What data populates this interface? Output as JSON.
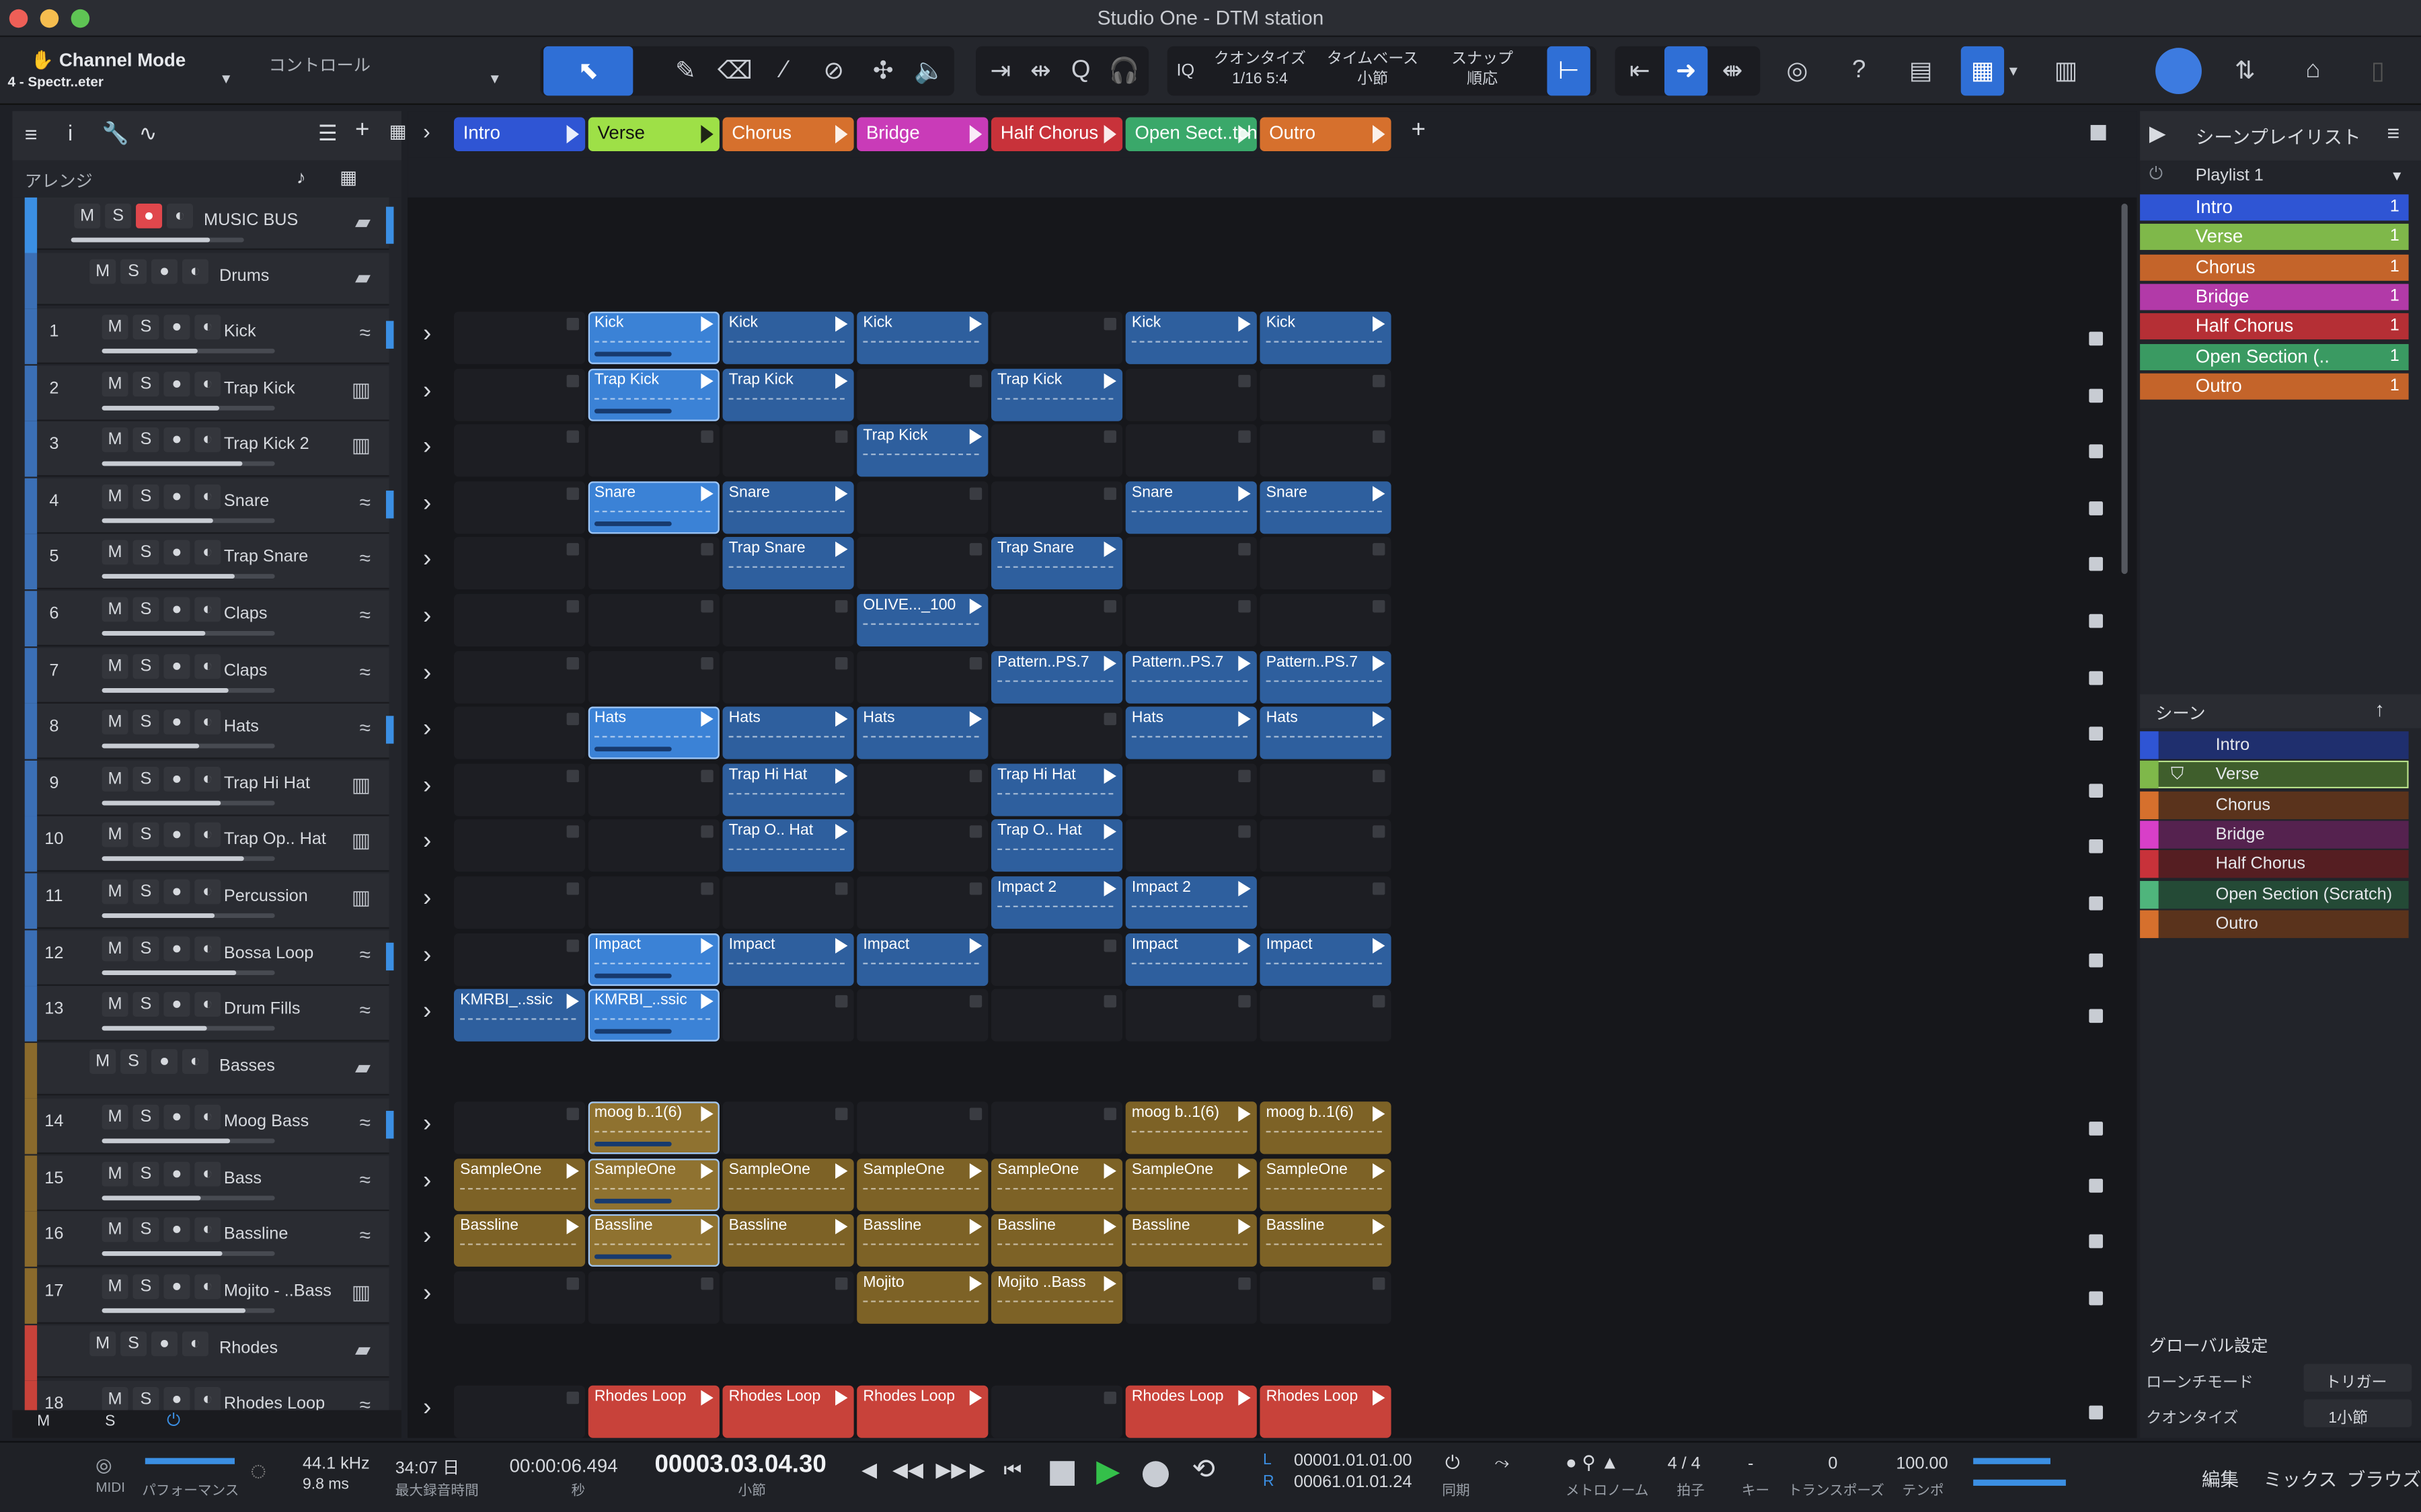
{
  "window": {
    "title": "Studio One - DTM station"
  },
  "toolbar": {
    "mode_title": "Channel Mode",
    "mode_sub": "4 - Spectr..eter",
    "control_label": "コントロール",
    "iq": "IQ",
    "quantize_label": "クオンタイズ",
    "quantize_value": "1/16 5:4",
    "timebase_label": "タイムベース",
    "timebase_value": "小節",
    "snap_label": "スナップ",
    "snap_value": "順応"
  },
  "left": {
    "arrange_label": "アレンジ",
    "music_bus": "MUSIC BUS",
    "drums": "Drums",
    "basses": "Basses",
    "rhodes": "Rhodes",
    "footer_m": "M",
    "footer_s": "S",
    "tracks": [
      {
        "n": "1",
        "name": "Kick"
      },
      {
        "n": "2",
        "name": "Trap Kick"
      },
      {
        "n": "3",
        "name": "Trap Kick 2"
      },
      {
        "n": "4",
        "name": "Snare"
      },
      {
        "n": "5",
        "name": "Trap Snare"
      },
      {
        "n": "6",
        "name": "Claps"
      },
      {
        "n": "7",
        "name": "Claps"
      },
      {
        "n": "8",
        "name": "Hats"
      },
      {
        "n": "9",
        "name": "Trap Hi Hat"
      },
      {
        "n": "10",
        "name": "Trap Op.. Hat"
      },
      {
        "n": "11",
        "name": "Percussion"
      },
      {
        "n": "12",
        "name": "Bossa Loop"
      },
      {
        "n": "13",
        "name": "Drum Fills"
      },
      {
        "n": "14",
        "name": "Moog Bass"
      },
      {
        "n": "15",
        "name": "Bass"
      },
      {
        "n": "16",
        "name": "Bassline"
      },
      {
        "n": "17",
        "name": "Mojito - ..Bass"
      },
      {
        "n": "18",
        "name": "Rhodes Loop"
      }
    ]
  },
  "scenes": [
    {
      "name": "Intro",
      "color": "#2f55d4"
    },
    {
      "name": "Verse",
      "color": "#9ee047"
    },
    {
      "name": "Chorus",
      "color": "#d6702d"
    },
    {
      "name": "Bridge",
      "color": "#c93bb8"
    },
    {
      "name": "Half Chorus",
      "color": "#c8323a"
    },
    {
      "name": "Open Sect..tch",
      "color": "#3aa86a"
    },
    {
      "name": "Outro",
      "color": "#d6702d"
    }
  ],
  "clip_rows": [
    [
      "",
      "Kick",
      "Kick",
      "Kick",
      "",
      "Kick",
      "Kick"
    ],
    [
      "",
      "Trap Kick",
      "Trap Kick",
      "",
      "Trap Kick",
      "",
      ""
    ],
    [
      "",
      "",
      "",
      "Trap Kick",
      "",
      "",
      ""
    ],
    [
      "",
      "Snare",
      "Snare",
      "",
      "",
      "Snare",
      "Snare"
    ],
    [
      "",
      "",
      "Trap Snare",
      "",
      "Trap Snare",
      "",
      ""
    ],
    [
      "",
      "",
      "",
      "OLIVE..._100",
      "",
      "",
      ""
    ],
    [
      "",
      "",
      "",
      "",
      "Pattern..PS.7",
      "Pattern..PS.7",
      "Pattern..PS.7"
    ],
    [
      "",
      "Hats",
      "Hats",
      "Hats",
      "",
      "Hats",
      "Hats"
    ],
    [
      "",
      "",
      "Trap Hi Hat",
      "",
      "Trap Hi Hat",
      "",
      ""
    ],
    [
      "",
      "",
      "Trap O.. Hat",
      "",
      "Trap O.. Hat",
      "",
      ""
    ],
    [
      "",
      "",
      "",
      "",
      "Impact 2",
      "Impact 2",
      ""
    ],
    [
      "",
      "Impact",
      "Impact",
      "Impact",
      "",
      "Impact",
      "Impact"
    ],
    [
      "KMRBI_..ssic",
      "KMRBI_..ssic",
      "",
      "",
      "",
      "",
      ""
    ],
    [
      "",
      "moog b..1(6)",
      "",
      "",
      "",
      "moog b..1(6)",
      "moog b..1(6)"
    ],
    [
      "SampleOne",
      "SampleOne",
      "SampleOne",
      "SampleOne",
      "SampleOne",
      "SampleOne",
      "SampleOne"
    ],
    [
      "Bassline",
      "Bassline",
      "Bassline",
      "Bassline",
      "Bassline",
      "Bassline",
      "Bassline"
    ],
    [
      "",
      "",
      "",
      "Mojito",
      "Mojito ..Bass",
      "",
      ""
    ],
    [
      "",
      "Rhodes Loop",
      "Rhodes Loop",
      "Rhodes Loop",
      "",
      "Rhodes Loop",
      "Rhodes Loop"
    ]
  ],
  "right": {
    "playlist_title": "シーンプレイリスト",
    "playlist_name": "Playlist 1",
    "playlist": [
      {
        "name": "Intro",
        "count": "1",
        "color": "#2f55d4"
      },
      {
        "name": "Verse",
        "count": "1",
        "color": "#7fb84a"
      },
      {
        "name": "Chorus",
        "count": "1",
        "color": "#c4642a"
      },
      {
        "name": "Bridge",
        "count": "1",
        "color": "#b23aa8"
      },
      {
        "name": "Half Chorus",
        "count": "1",
        "color": "#b52f35"
      },
      {
        "name": "Open Section (..",
        "count": "1",
        "color": "#3a9a62"
      },
      {
        "name": "Outro",
        "count": "1",
        "color": "#c4642a"
      }
    ],
    "scene_title": "シーン",
    "scene_list": [
      {
        "name": "Intro",
        "color": "#2f55d4",
        "bg": "#1f2f6e"
      },
      {
        "name": "Verse",
        "color": "#7fb84a",
        "bg": "#3f5e2c"
      },
      {
        "name": "Chorus",
        "color": "#d6702d",
        "bg": "#5a331c"
      },
      {
        "name": "Bridge",
        "color": "#d83fc8",
        "bg": "#55224f"
      },
      {
        "name": "Half Chorus",
        "color": "#c8323a",
        "bg": "#551e22"
      },
      {
        "name": "Open Section (Scratch)",
        "color": "#4fb57c",
        "bg": "#244a36"
      },
      {
        "name": "Outro",
        "color": "#d6702d",
        "bg": "#5a331c"
      }
    ],
    "global_settings": "グローバル設定",
    "launch_mode_label": "ローンチモード",
    "launch_mode_value": "トリガー",
    "quantize_label": "クオンタイズ",
    "quantize_value": "1小節"
  },
  "transport": {
    "midi": "MIDI",
    "performance": "パフォーマンス",
    "sample_rate": "44.1 kHz",
    "latency": "9.8 ms",
    "record_days": "34:07 日",
    "record_label": "最大録音時間",
    "seconds_value": "00:00:06.494",
    "seconds_label": "秒",
    "bars_value": "00003.03.04.30",
    "bars_label": "小節",
    "loop_l": "00001.01.01.00",
    "loop_r": "00061.01.01.24",
    "sync_label": "同期",
    "metronome_label": "メトロノーム",
    "signature": "4 / 4",
    "signature_label": "拍子",
    "key_value": "-",
    "key_label": "キー",
    "transpose_value": "0",
    "transpose_label": "トランスポーズ",
    "tempo_value": "100.00",
    "tempo_label": "テンポ",
    "tab_edit": "編集",
    "tab_mix": "ミックス",
    "tab_browse": "ブラウズ"
  }
}
